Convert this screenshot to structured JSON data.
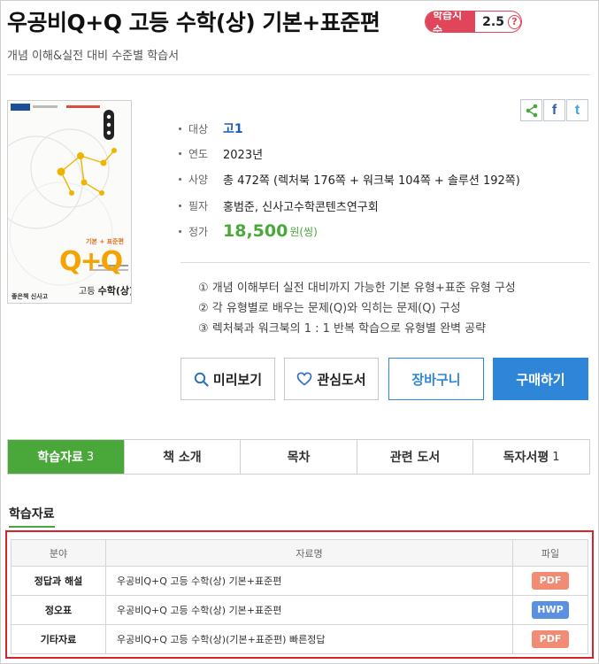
{
  "header": {
    "title": "우공비Q+Q 고등 수학(상) 기본+표준편",
    "subtitle": "개념 이해&실전 대비 수준별 학습서",
    "badge_label": "학습지수",
    "badge_value": "2.5",
    "badge_help": "?"
  },
  "cover": {
    "brand": "좋은책 신사고",
    "series_label": "기본 + 표준편",
    "logo_text": "Q+Q",
    "book_subject_prefix": "고등",
    "book_subject": "수학(상)"
  },
  "share": {
    "icons": [
      "share-icon",
      "facebook-icon",
      "twitter-icon"
    ],
    "facebook_glyph": "f",
    "twitter_glyph": "t"
  },
  "info": {
    "target_label": "대상",
    "target_value": "고1",
    "year_label": "연도",
    "year_value": "2023년",
    "spec_label": "사양",
    "spec_value": "총 472쪽 (렉처북 176쪽 + 워크북 104쪽 + 솔루션 192쪽)",
    "author_label": "필자",
    "author_value": "홍범준, 신사고수학콘텐츠연구회",
    "price_label": "정가",
    "price_value": "18,500",
    "price_unit": "원(씽)"
  },
  "features": [
    "① 개념 이해부터 실전 대비까지 가능한 기본 유형+표준 유형 구성",
    "② 각 유형별로 배우는 문제(Q)와 익히는 문제(Q) 구성",
    "③ 렉처북과 워크북의 1 : 1 반복 학습으로 유형별 완벽 공략"
  ],
  "buttons": {
    "preview": "미리보기",
    "wishlist": "관심도서",
    "cart": "장바구니",
    "buy": "구매하기"
  },
  "tabs": [
    {
      "label": "학습자료",
      "count": "3"
    },
    {
      "label": "책 소개",
      "count": ""
    },
    {
      "label": "목차",
      "count": ""
    },
    {
      "label": "관련 도서",
      "count": ""
    },
    {
      "label": "독자서평",
      "count": "1"
    }
  ],
  "materials": {
    "section_title": "학습자료",
    "headers": {
      "category": "분야",
      "name": "자료명",
      "file": "파일"
    },
    "rows": [
      {
        "category": "정답과 해설",
        "name": "우공비Q+Q 고등 수학(상) 기본+표준편",
        "file": "PDF"
      },
      {
        "category": "정오표",
        "name": "우공비Q+Q 고등 수학(상) 기본+표준편",
        "file": "HWP"
      },
      {
        "category": "기타자료",
        "name": "우공비Q+Q 고등 수학(상)(기본+표준편) 빠른정답",
        "file": "PDF"
      }
    ]
  },
  "colors": {
    "accent_green": "#4aa83a",
    "accent_blue": "#2f86d8",
    "badge_red": "#e0455a",
    "highlight_red": "#d8232a",
    "pdf_orange": "#f28b73",
    "hwp_blue": "#5b8fe0"
  }
}
